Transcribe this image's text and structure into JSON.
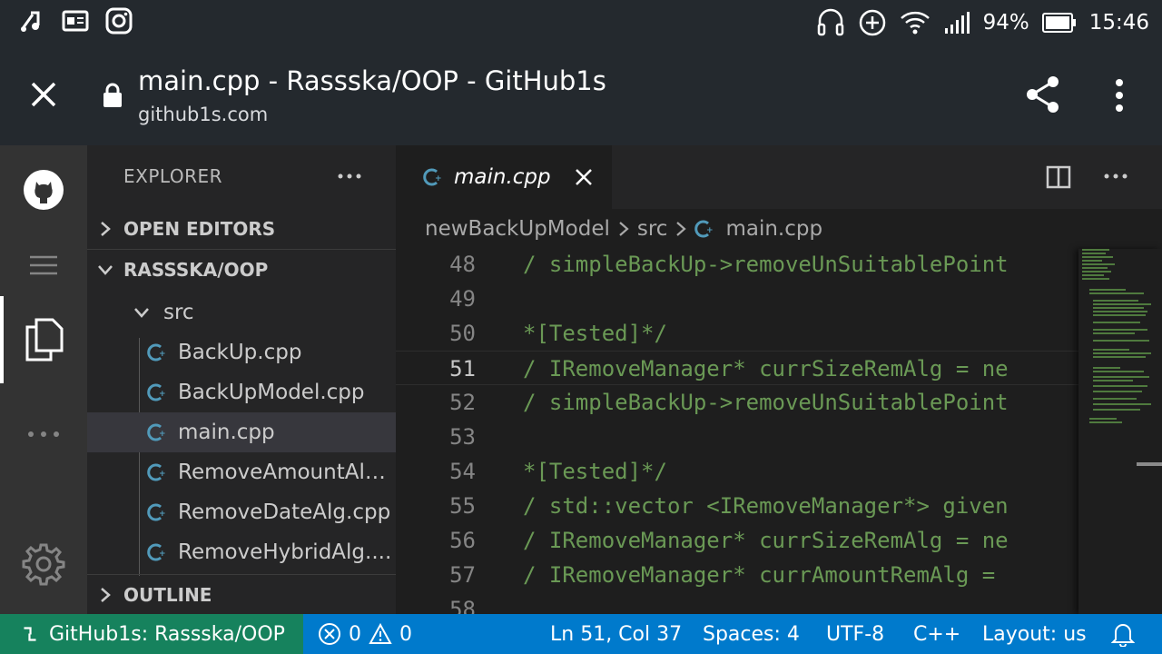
{
  "status_bar": {
    "battery": "94%",
    "time": "15:46"
  },
  "browser": {
    "title": "main.cpp - Rassska/OOP - GitHub1s",
    "url": "github1s.com"
  },
  "sidebar": {
    "header": "EXPLORER",
    "open_editors": "OPEN EDITORS",
    "repo": "RASSSKA/OOP",
    "folder": "src",
    "files": [
      "BackUp.cpp",
      "BackUpModel.cpp",
      "main.cpp",
      "RemoveAmountAlg...",
      "RemoveDateAlg.cpp",
      "RemoveHybridAlg...."
    ],
    "outline": "OUTLINE"
  },
  "editor": {
    "tab_label": "main.cpp",
    "breadcrumb": [
      "newBackUpModel",
      "src",
      "main.cpp"
    ],
    "lines": [
      {
        "num": "48",
        "text": "/ simpleBackUp->removeUnSuitablePoint"
      },
      {
        "num": "49",
        "text": ""
      },
      {
        "num": "50",
        "text": "*[Tested]*/"
      },
      {
        "num": "51",
        "text": "/ IRemoveManager* currSizeRemAlg = ne"
      },
      {
        "num": "52",
        "text": "/ simpleBackUp->removeUnSuitablePoint"
      },
      {
        "num": "53",
        "text": ""
      },
      {
        "num": "54",
        "text": "*[Tested]*/"
      },
      {
        "num": "55",
        "text": "/ std::vector <IRemoveManager*> given"
      },
      {
        "num": "56",
        "text": "/ IRemoveManager* currSizeRemAlg = ne"
      },
      {
        "num": "57",
        "text": "/ IRemoveManager* currAmountRemAlg = "
      },
      {
        "num": "58",
        "text": ""
      }
    ],
    "current_line": "51"
  },
  "footer": {
    "remote": "GitHub1s: Rassska/OOP",
    "errors": "0",
    "warnings": "0",
    "position": "Ln 51, Col 37",
    "spaces": "Spaces: 4",
    "encoding": "UTF-8",
    "language": "C++",
    "layout": "Layout: us"
  },
  "colors": {
    "status_bar_blue": "#007acc",
    "remote_green": "#16825d",
    "comment_green": "#6a9955",
    "browser_bar": "#24292e"
  }
}
